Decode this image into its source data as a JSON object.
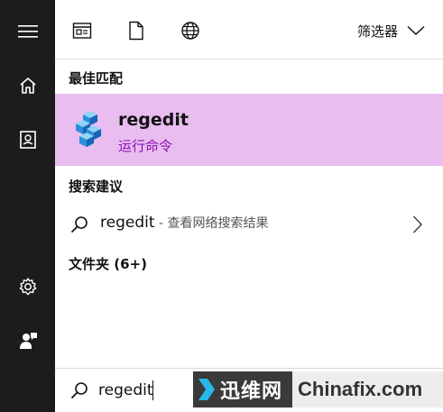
{
  "topbar": {
    "filter_label": "筛选器"
  },
  "best_match": {
    "section_title": "最佳匹配",
    "name": "regedit",
    "type": "运行命令"
  },
  "suggestions": {
    "section_title": "搜索建议",
    "query": "regedit",
    "extra": " - 查看网络搜索结果"
  },
  "folders": {
    "section_title": "文件夹 (6+)"
  },
  "search": {
    "value": "regedit"
  },
  "watermark": {
    "cn": "迅维网",
    "en": "Chinafix.com"
  },
  "colors": {
    "rail": "#1c1c1c",
    "highlight": "#e9bdf0",
    "accent_text": "#8a12b0"
  },
  "icons": {
    "rail": [
      "hamburger-menu-icon",
      "home-icon",
      "notebook-icon",
      "settings-gear-icon",
      "user-feedback-icon"
    ],
    "topbar": [
      "apps-icon",
      "document-icon",
      "globe-icon",
      "chevron-down-icon"
    ],
    "best_match": "registry-editor-icon",
    "suggestion": [
      "search-icon",
      "chevron-right-icon"
    ],
    "searchbox": "search-icon"
  }
}
